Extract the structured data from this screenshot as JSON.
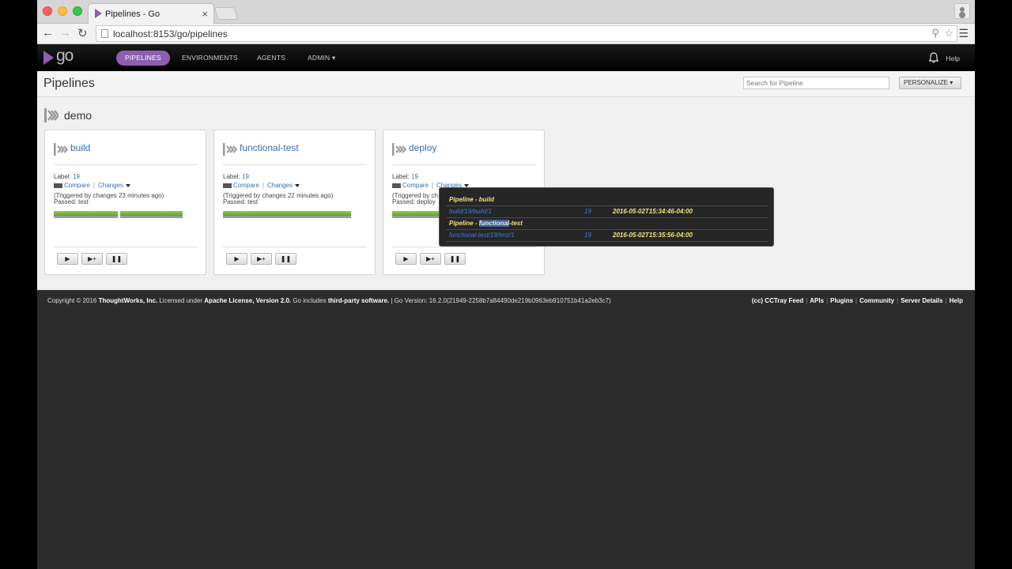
{
  "browser": {
    "tab_title": "Pipelines - Go",
    "tab_close": "×",
    "url": "localhost:8153/go/pipelines"
  },
  "header": {
    "logo": "go",
    "nav": [
      "PIPELINES",
      "ENVIRONMENTS",
      "AGENTS",
      "ADMIN ▾"
    ],
    "help": "Help"
  },
  "page": {
    "title": "Pipelines",
    "search_placeholder": "Search for Pipeline",
    "personalize": "PERSONALIZE ▾"
  },
  "group": {
    "name": "demo"
  },
  "pipelines": [
    {
      "name": "build",
      "label_prefix": "Label: ",
      "label": "19",
      "compare": "Compare",
      "changes": "Changes",
      "triggered": "(Triggered by changes 23 minutes ago)",
      "passed": "Passed: test"
    },
    {
      "name": "functional-test",
      "label_prefix": "Label: ",
      "label": "19",
      "compare": "Compare",
      "changes": "Changes",
      "triggered": "(Triggered by changes 22 minutes ago)",
      "passed": "Passed: test"
    },
    {
      "name": "deploy",
      "label_prefix": "Label: ",
      "label": "19",
      "compare": "Compare",
      "changes": "Changes",
      "triggered": "(Triggered by ch",
      "passed": "Passed: deploy"
    }
  ],
  "controls": {
    "play": "▶",
    "play_with_options": "▶+",
    "pause": "❚❚"
  },
  "tooltip": {
    "rows": [
      {
        "heading": "Pipeline - build",
        "link": "build/19/build/1",
        "label": "19",
        "date": "2016-05-02T15:34:46-04:00"
      },
      {
        "heading_prefix": "Pipeline - ",
        "heading_highlight": "functional",
        "heading_suffix": "-test",
        "link": "functional-test/19/test/1",
        "label": "19",
        "date": "2016-05-02T15:35:56-04:00"
      }
    ]
  },
  "footer": {
    "copyright": "Copyright © 2016 ",
    "company": "ThoughtWorks, Inc.",
    "licensed": " Licensed under ",
    "license": "Apache License, Version 2.0.",
    "includes": " Go includes ",
    "third_party": "third-party software.",
    "version": " | Go Version: 16.2.0(21949-2258b7a84490de219b0963eb910751b41a2eb3c7)",
    "links": [
      "(cc) CCTray Feed",
      "APIs",
      "Plugins",
      "Community",
      "Server Details",
      "Help"
    ]
  }
}
